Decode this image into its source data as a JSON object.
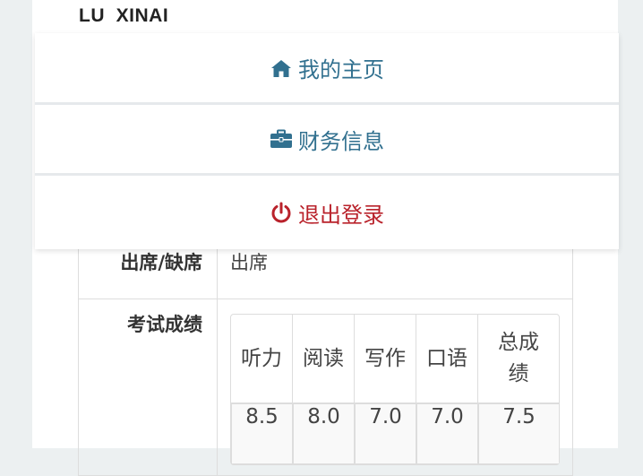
{
  "user": {
    "name": "LU  XINAI"
  },
  "menu": {
    "items": [
      {
        "label": "我的主页",
        "icon": "home-icon"
      },
      {
        "label": "财务信息",
        "icon": "briefcase-icon"
      },
      {
        "label": "退出登录",
        "icon": "power-icon"
      }
    ]
  },
  "info": {
    "attendance_label": "出席/缺席",
    "attendance_value": "出席",
    "scores_label": "考试成绩",
    "scores": {
      "headers": [
        "听力",
        "阅读",
        "写作",
        "口语",
        "总成绩"
      ],
      "values": [
        "8.5",
        "8.0",
        "7.0",
        "7.0",
        "7.5"
      ]
    }
  },
  "colors": {
    "link_blue": "#31708f",
    "logout_red": "#b9222b",
    "background": "#ecf0f1"
  }
}
